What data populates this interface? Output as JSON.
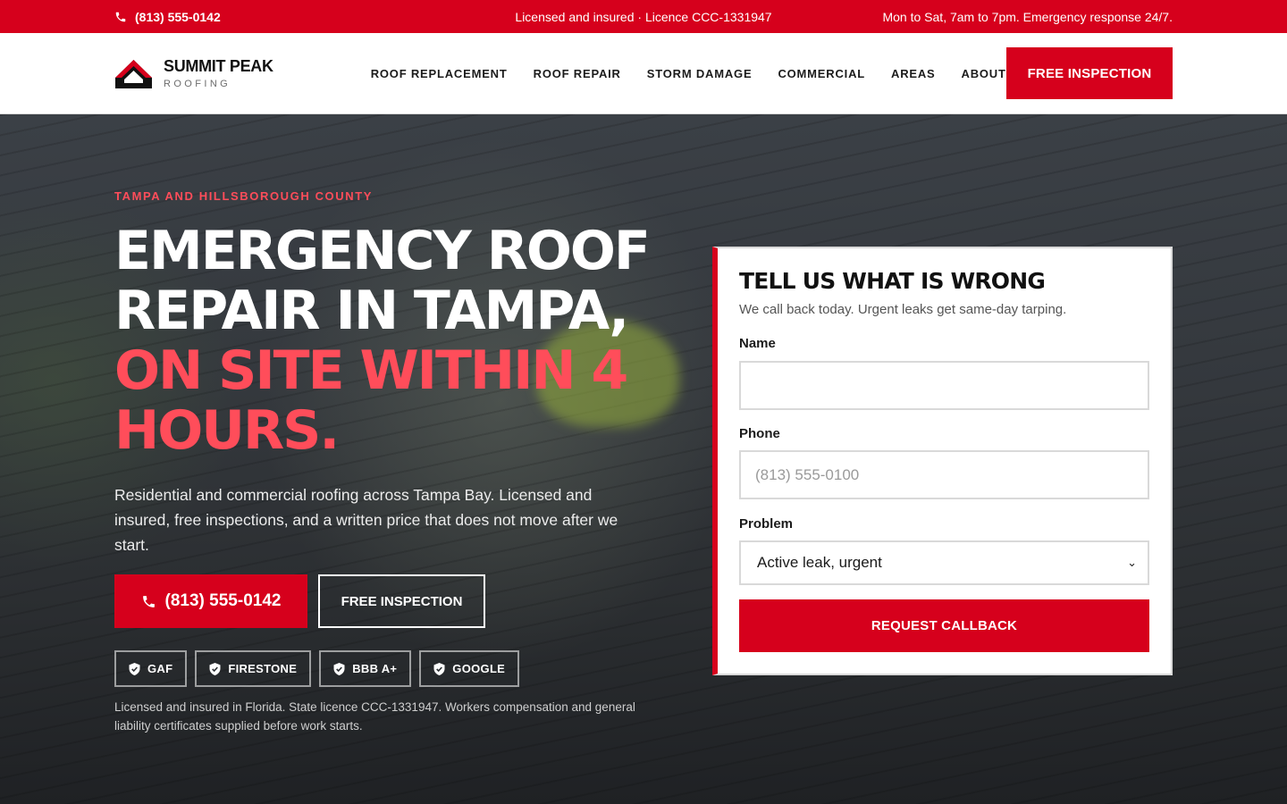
{
  "topbar": {
    "phone": "(813) 555-0142",
    "licence": "Licensed and insured · Licence CCC-1331947",
    "hours": "Mon to Sat, 7am to 7pm. Emergency response 24/7."
  },
  "header": {
    "brand": "SUMMIT PEAK",
    "brand_sub": "ROOFING",
    "nav": [
      "ROOF REPLACEMENT",
      "ROOF REPAIR",
      "STORM DAMAGE",
      "COMMERCIAL",
      "AREAS",
      "ABOUT"
    ],
    "cta": "FREE INSPECTION"
  },
  "hero": {
    "eyebrow": "TAMPA AND HILLSBOROUGH COUNTY",
    "headline_plain": "EMERGENCY ROOF REPAIR IN TAMPA,",
    "headline_accent": "ON SITE WITHIN 4 HOURS.",
    "lede": "Residential and commercial roofing across Tampa Bay. Licensed and insured, free inspections, and a written price that does not move after we start.",
    "phone_button": "(813) 555-0142",
    "inspection_button": "FREE INSPECTION",
    "badges": [
      "GAF",
      "FIRESTONE",
      "BBB A+",
      "GOOGLE"
    ],
    "legal": "Licensed and insured in Florida. State licence CCC-1331947. Workers compensation and general liability certificates supplied before work starts."
  },
  "form": {
    "title": "TELL US WHAT IS WRONG",
    "subtitle": "We call back today. Urgent leaks get same-day tarping.",
    "name_label": "Name",
    "name_value": "",
    "phone_label": "Phone",
    "phone_placeholder": "(813) 555-0100",
    "problem_label": "Problem",
    "problem_value": "Active leak, urgent",
    "submit": "REQUEST CALLBACK"
  },
  "colors": {
    "brand_red": "#d6001c",
    "accent_red": "#ff4d5a"
  }
}
